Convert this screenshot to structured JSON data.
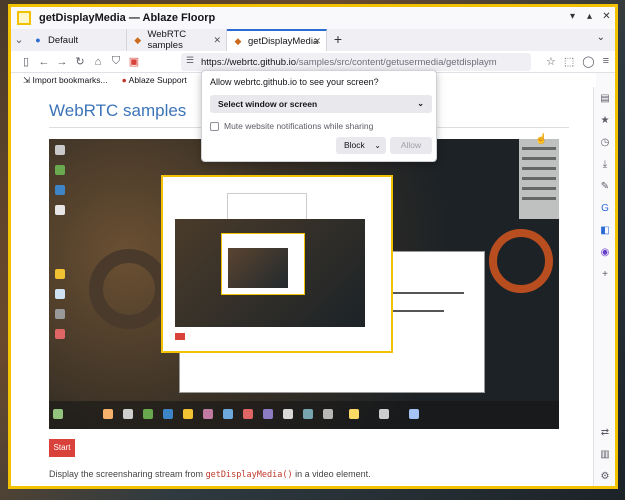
{
  "window": {
    "title": "getDisplayMedia — Ablaze Floorp"
  },
  "tabs": [
    {
      "label": "Default",
      "icon": "floorp-icon"
    },
    {
      "label": "WebRTC samples",
      "icon": "webrtc-icon"
    },
    {
      "label": "getDisplayMedia",
      "icon": "webrtc-icon",
      "active": true
    }
  ],
  "navbar": {
    "url_host": "https://webrtc.github.io",
    "url_path": "/samples/src/content/getusermedia/getdisplaym"
  },
  "bookmarks": [
    {
      "label": "Import bookmarks...",
      "icon": "import-icon"
    },
    {
      "label": "Ablaze Support",
      "icon": "ablaze-icon"
    }
  ],
  "page": {
    "heading": "WebRTC samples",
    "start_label": "Start",
    "description_before": "Display the screensharing stream from ",
    "description_code": "getDisplayMedia()",
    "description_after": " in a video element."
  },
  "prompt": {
    "title": "Allow webrtc.github.io to see your screen?",
    "select_label": "Select window or screen",
    "mute_label": "Mute website notifications while sharing",
    "mute_checked": false,
    "block_label": "Block",
    "allow_label": "Allow"
  },
  "colors": {
    "accent": "#2b6bd6",
    "window_border": "#f2c100",
    "heading": "#3c74b8",
    "start_button": "#d9423a"
  }
}
